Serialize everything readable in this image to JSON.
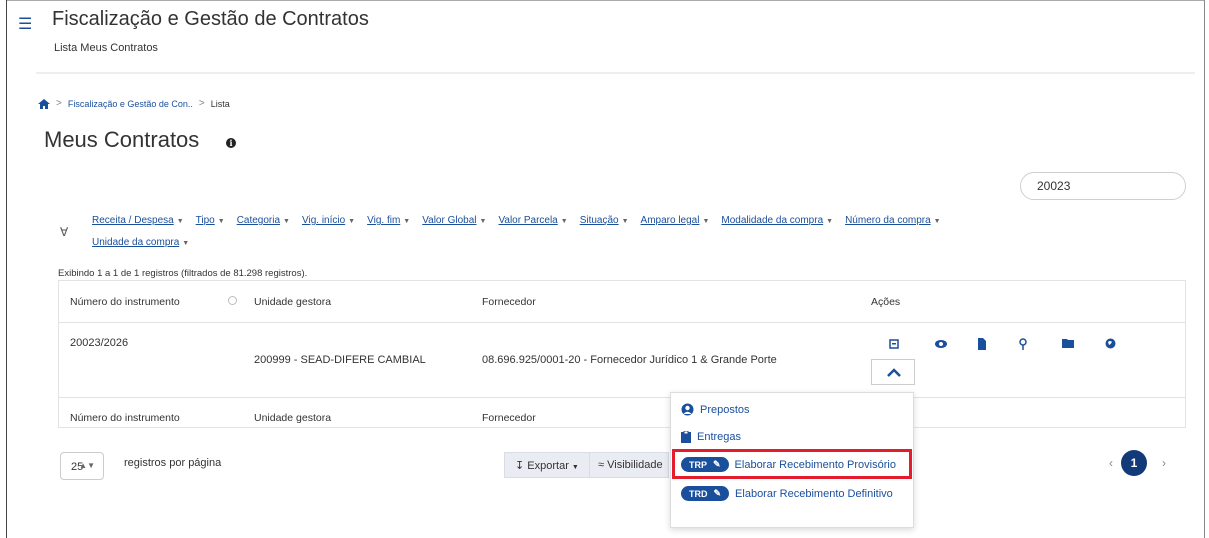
{
  "header": {
    "title": "Fiscalização e Gestão de Contratos",
    "subtitle": "Lista Meus Contratos"
  },
  "breadcrumb": {
    "items": [
      "Fiscalização e Gestão de Con..",
      "Lista"
    ]
  },
  "page": {
    "title": "Meus Contratos"
  },
  "search": {
    "value": "20023"
  },
  "filters": {
    "row1": [
      "Receita / Despesa",
      "Tipo",
      "Categoria",
      "Vig. início",
      "Vig. fim",
      "Valor Global",
      "Valor Parcela",
      "Situação",
      "Amparo legal",
      "Modalidade da compra",
      "Número da compra"
    ],
    "row2": [
      "Unidade da compra"
    ]
  },
  "records_info": "Exibindo 1 a 1 de 1 registros (filtrados de 81.298 registros).",
  "table": {
    "headers": [
      "Número do instrumento",
      "Unidade gestora",
      "Fornecedor",
      "Ações"
    ],
    "rows": [
      {
        "numero": "20023/2026",
        "unidade": "200999 - SEAD-DIFERE CAMBIAL",
        "fornecedor": "08.696.925/0001-20 - Fornecedor Jurídico 1 & Grande Porte"
      }
    ],
    "footer_headers": [
      "Número do instrumento",
      "Unidade gestora",
      "Fornecedor"
    ]
  },
  "actions_menu": {
    "items": [
      {
        "label": "Prepostos",
        "icon": "user-circle-icon"
      },
      {
        "label": "Entregas",
        "icon": "clipboard-icon"
      },
      {
        "badge": "TRP",
        "label": "Elaborar Recebimento Provisório",
        "icon": "edit-icon"
      },
      {
        "badge": "TRD",
        "label": "Elaborar Recebimento Definitivo",
        "icon": "edit-icon"
      }
    ]
  },
  "pagination": {
    "page_size": "25",
    "per_page_label": "registros por página",
    "export_label": "Exportar",
    "visibility_label": "Visibilidade",
    "current_page": "1",
    "prev": "‹",
    "next": "›"
  },
  "colors": {
    "primary": "#1a4f9c",
    "highlight": "#e31d2b",
    "page_active": "#123a78"
  }
}
